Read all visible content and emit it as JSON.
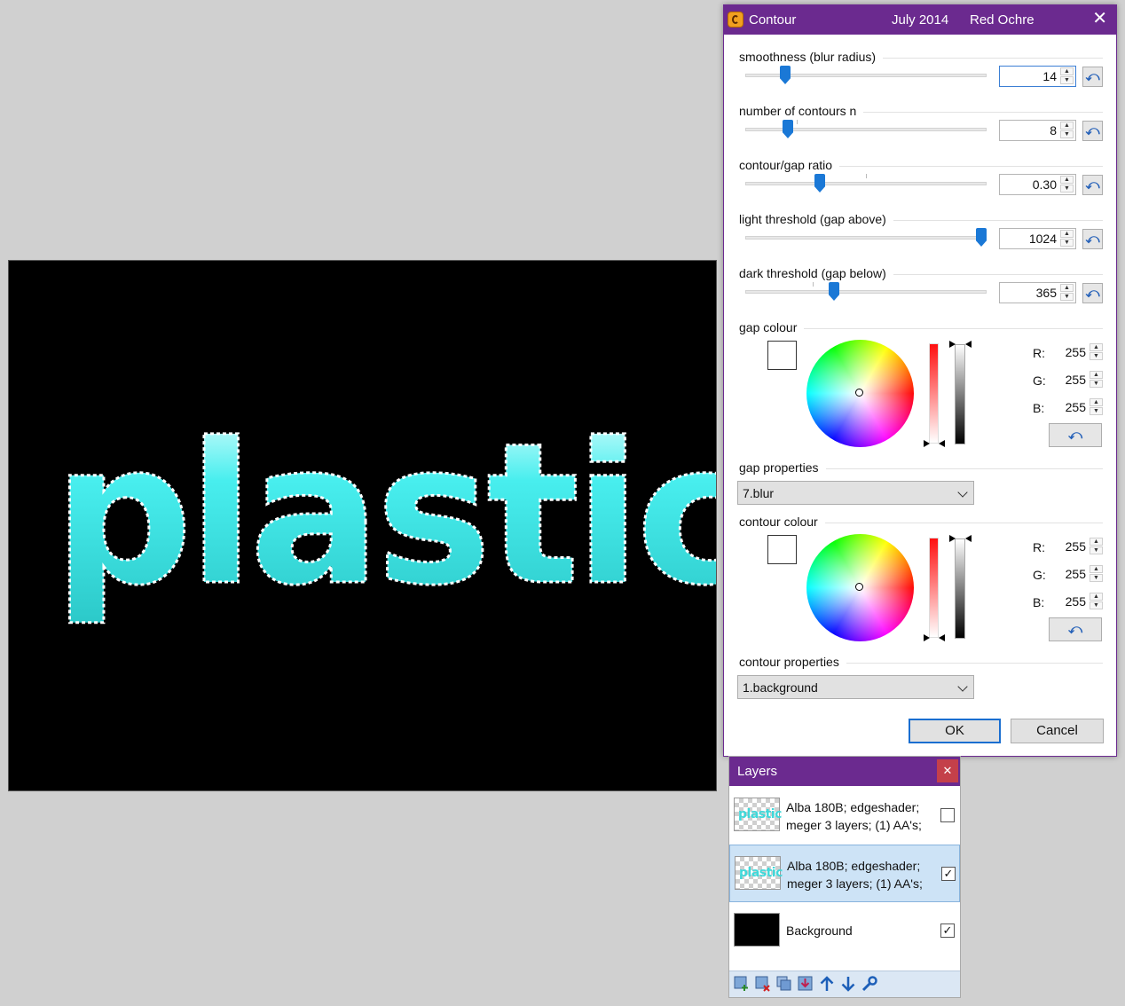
{
  "canvas": {
    "text": "plastic",
    "fill_color": "#3ee6e6",
    "background_color": "#000000"
  },
  "dialog": {
    "title": "Contour",
    "date": "July 2014",
    "author": "Red Ochre",
    "close_icon": "close-icon",
    "sliders": [
      {
        "label": "smoothness (blur radius)",
        "value": "14",
        "fraction": 0.15
      },
      {
        "label": "number of contours n",
        "value": "8",
        "fraction": 0.16
      },
      {
        "label": "contour/gap ratio",
        "value": "0.30",
        "fraction": 0.3
      },
      {
        "label": "light threshold (gap above)",
        "value": "1024",
        "fraction": 1.0
      },
      {
        "label": "dark threshold (gap below)",
        "value": "365",
        "fraction": 0.36
      }
    ],
    "gap_colour": {
      "label": "gap colour",
      "r_label": "R:",
      "g_label": "G:",
      "b_label": "B:",
      "r": "255",
      "g": "255",
      "b": "255",
      "swatch": "#ffffff"
    },
    "gap_properties": {
      "label": "gap properties",
      "selected": "7.blur"
    },
    "contour_colour": {
      "label": "contour colour",
      "r_label": "R:",
      "g_label": "G:",
      "b_label": "B:",
      "r": "255",
      "g": "255",
      "b": "255",
      "swatch": "#ffffff"
    },
    "contour_properties": {
      "label": "contour properties",
      "selected": "1.background"
    },
    "ok_label": "OK",
    "cancel_label": "Cancel",
    "accent": "#6b2a8f"
  },
  "layers": {
    "title": "Layers",
    "items": [
      {
        "name": "Alba 180B; edgeshader; meger 3 layers; (1) AA's;",
        "visible": true,
        "checked": false,
        "selected": false,
        "thumb_text": "plastic"
      },
      {
        "name": "Alba 180B; edgeshader; meger 3 layers; (1) AA's;",
        "visible": true,
        "checked": true,
        "selected": true,
        "thumb_text": "plastic"
      },
      {
        "name": "Background",
        "visible": true,
        "checked": true,
        "selected": false
      }
    ],
    "tools": [
      "add-layer-icon",
      "delete-layer-icon",
      "duplicate-layer-icon",
      "merge-layer-down-icon",
      "move-layer-up-icon",
      "move-layer-down-icon",
      "layer-properties-icon"
    ]
  }
}
